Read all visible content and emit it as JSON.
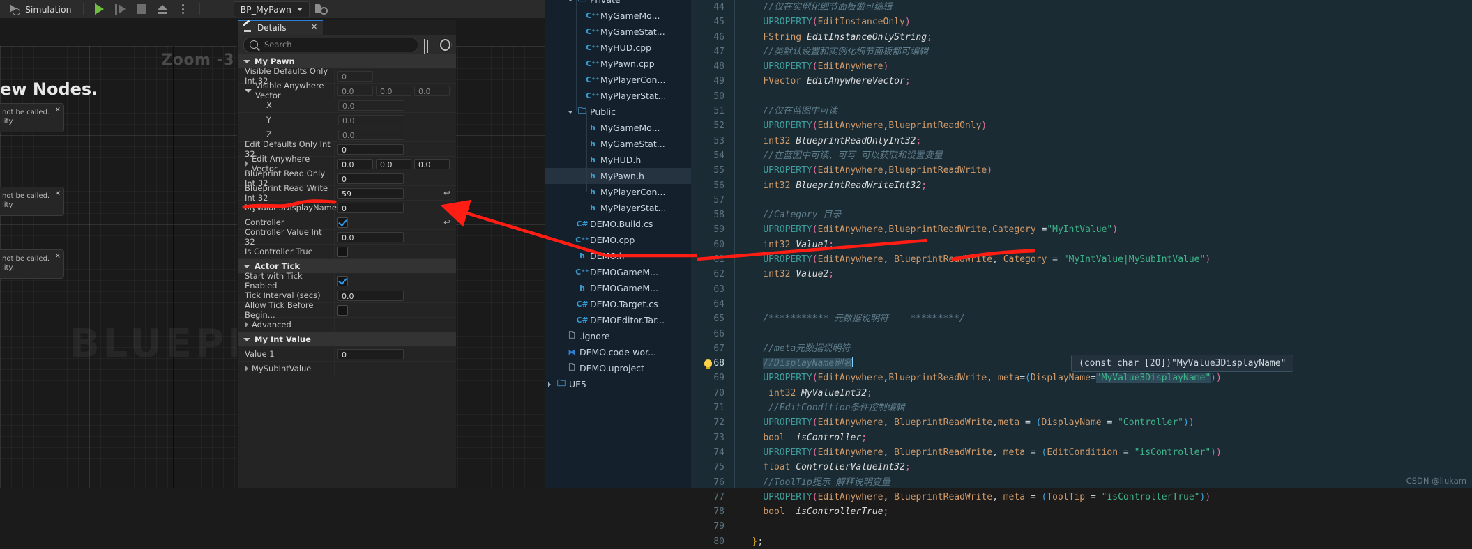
{
  "ue": {
    "toolbar": {
      "simulation_label": "Simulation",
      "play_icon": "play-icon",
      "skip_icon": "step-icon",
      "stop_icon": "stop-icon",
      "eject_icon": "eject-icon",
      "more_icon": "kebab-menu-icon",
      "blueprint_combo": "BP_MyPawn",
      "browse_icon": "browse-asset-icon"
    },
    "viewport": {
      "zoom_label": "Zoom -3",
      "watermark": "BLUEPRINT",
      "new_nodes_text": "New Nodes.",
      "comment_nodes": [
        {
          "text": "not be called.\nlity."
        },
        {
          "text": "not be called.\nlity."
        },
        {
          "text": "not be called.\nlity."
        }
      ]
    }
  },
  "details": {
    "tab_title": "Details",
    "tab_icon": "details-pen-icon",
    "close_icon": "close-icon",
    "search_placeholder": "Search",
    "search_value": "",
    "grid_icon": "column-layout-icon",
    "settings_icon": "gear-icon",
    "sections": [
      {
        "title": "My Pawn",
        "expanded": true,
        "rows": [
          {
            "label": "Visible Defaults Only Int 32",
            "type": "number",
            "value": "0",
            "dim": true,
            "indent": 1
          },
          {
            "label": "Visible Anywhere Vector",
            "type": "vector",
            "values": [
              "0.0",
              "0.0",
              "0.0"
            ],
            "dim": true,
            "indent": 1,
            "expanded": true
          },
          {
            "label": "X",
            "type": "number",
            "value": "0.0",
            "dim": true,
            "indent": 2,
            "wide": true
          },
          {
            "label": "Y",
            "type": "number",
            "value": "0.0",
            "dim": true,
            "indent": 2,
            "wide": true
          },
          {
            "label": "Z",
            "type": "number",
            "value": "0.0",
            "dim": true,
            "indent": 2,
            "wide": true
          },
          {
            "label": "Edit Defaults Only Int 32",
            "type": "number",
            "value": "0",
            "indent": 1,
            "wide": true
          },
          {
            "label": "Edit Anywhere Vector",
            "type": "vector",
            "values": [
              "0.0",
              "0.0",
              "0.0"
            ],
            "indent": 1,
            "collapsed": true
          },
          {
            "label": "Blueprint Read Only Int 32",
            "type": "number",
            "value": "0",
            "indent": 1,
            "wide": true
          },
          {
            "label": "Blueprint Read Write Int 32",
            "type": "number",
            "value": "59",
            "indent": 1,
            "wide": true,
            "revert": true
          },
          {
            "label": "MyValue3DisplayName",
            "type": "number",
            "value": "0",
            "indent": 1,
            "wide": true
          },
          {
            "label": "Controller",
            "type": "checkbox",
            "checked": true,
            "indent": 1,
            "revert": true
          },
          {
            "label": "Controller Value Int 32",
            "type": "number",
            "value": "0.0",
            "indent": 1,
            "wide": true
          },
          {
            "label": "Is Controller True",
            "type": "checkbox",
            "checked": false,
            "indent": 1
          }
        ]
      },
      {
        "title": "Actor Tick",
        "expanded": true,
        "rows": [
          {
            "label": "Start with Tick Enabled",
            "type": "checkbox",
            "checked": true,
            "indent": 1
          },
          {
            "label": "Tick Interval (secs)",
            "type": "number",
            "value": "0.0",
            "indent": 1,
            "wide": true
          },
          {
            "label": "Allow Tick Before Begin...",
            "type": "checkbox",
            "checked": false,
            "indent": 1
          },
          {
            "label": "Advanced",
            "type": "group",
            "collapsed": true,
            "indent": 0
          }
        ]
      },
      {
        "title": "My Int Value",
        "expanded": true,
        "rows": [
          {
            "label": "Value 1",
            "type": "number",
            "value": "0",
            "indent": 1,
            "wide": true
          },
          {
            "label": "MySubIntValue",
            "type": "group",
            "collapsed": true,
            "indent": 0
          }
        ]
      }
    ]
  },
  "explorer": {
    "items": [
      {
        "label": "Private",
        "icon": "folder-icon",
        "indent": 2,
        "chevron": "down",
        "partial": true
      },
      {
        "label": "MyGameMo...",
        "icon": "cpp-icon",
        "indent": 3
      },
      {
        "label": "MyGameStat...",
        "icon": "cpp-icon",
        "indent": 3
      },
      {
        "label": "MyHUD.cpp",
        "icon": "cpp-icon",
        "indent": 3
      },
      {
        "label": "MyPawn.cpp",
        "icon": "cpp-icon",
        "indent": 3
      },
      {
        "label": "MyPlayerCon...",
        "icon": "cpp-icon",
        "indent": 3
      },
      {
        "label": "MyPlayerStat...",
        "icon": "cpp-icon",
        "indent": 3
      },
      {
        "label": "Public",
        "icon": "folder-icon",
        "indent": 2,
        "chevron": "down"
      },
      {
        "label": "MyGameMo...",
        "icon": "h-icon",
        "indent": 3
      },
      {
        "label": "MyGameStat...",
        "icon": "h-icon",
        "indent": 3
      },
      {
        "label": "MyHUD.h",
        "icon": "h-icon",
        "indent": 3
      },
      {
        "label": "MyPawn.h",
        "icon": "h-icon",
        "indent": 3,
        "selected": true
      },
      {
        "label": "MyPlayerCon...",
        "icon": "h-icon",
        "indent": 3
      },
      {
        "label": "MyPlayerStat...",
        "icon": "h-icon",
        "indent": 3
      },
      {
        "label": "DEMO.Build.cs",
        "icon": "csharp-icon",
        "indent": 2
      },
      {
        "label": "DEMO.cpp",
        "icon": "cpp-icon",
        "indent": 2
      },
      {
        "label": "DEMO.h",
        "icon": "h-icon",
        "indent": 2
      },
      {
        "label": "DEMOGameM...",
        "icon": "cpp-icon",
        "indent": 2
      },
      {
        "label": "DEMOGameM...",
        "icon": "h-icon",
        "indent": 2
      },
      {
        "label": "DEMO.Target.cs",
        "icon": "csharp-icon",
        "indent": 2
      },
      {
        "label": "DEMOEditor.Tar...",
        "icon": "csharp-icon",
        "indent": 2
      },
      {
        "label": ".ignore",
        "icon": "file-icon",
        "indent": 1
      },
      {
        "label": "DEMO.code-wor...",
        "icon": "vscode-icon",
        "indent": 1
      },
      {
        "label": "DEMO.uproject",
        "icon": "file-icon",
        "indent": 1
      },
      {
        "label": "UE5",
        "icon": "folder-plain-icon",
        "indent": 0,
        "chevron": "right"
      }
    ]
  },
  "editor": {
    "first_line": 44,
    "cursor_line": 68,
    "bulb_icon": "lightbulb-icon",
    "lines": [
      {
        "n": 44,
        "html": "    <span class=\"cmt\">//仅在实例化细节面板做可编辑</span>"
      },
      {
        "n": 45,
        "html": "    <span class=\"kw\">UPROPERTY</span><span class=\"pn\">(</span><span class=\"ty\">EditInstanceOnly</span><span class=\"pn\">)</span>"
      },
      {
        "n": 46,
        "html": "    <span class=\"ty\">FString</span> <span class=\"id\">EditInstanceOnlyString</span><span class=\"pn\">;</span>"
      },
      {
        "n": 47,
        "html": "    <span class=\"cmt\">//类默认设置和实例化细节面板都可编辑</span>"
      },
      {
        "n": 48,
        "html": "    <span class=\"kw\">UPROPERTY</span><span class=\"pn\">(</span><span class=\"ty\">EditAnywhere</span><span class=\"pn\">)</span>"
      },
      {
        "n": 49,
        "html": "    <span class=\"ty\">FVector</span> <span class=\"id\">EditAnywhereVector</span><span class=\"pn\">;</span>"
      },
      {
        "n": 50,
        "html": ""
      },
      {
        "n": 51,
        "html": "    <span class=\"cmt\">//仅在蓝图中可读</span>"
      },
      {
        "n": 52,
        "html": "    <span class=\"kw\">UPROPERTY</span><span class=\"pn\">(</span><span class=\"ty\">EditAnywhere</span><span class=\"punct\">,</span><span class=\"ty\">BlueprintReadOnly</span><span class=\"pn\">)</span>"
      },
      {
        "n": 53,
        "html": "    <span class=\"ty\">int32</span> <span class=\"id\">BlueprintReadOnlyInt32</span><span class=\"pn\">;</span>"
      },
      {
        "n": 54,
        "html": "    <span class=\"cmt\">//在蓝图中可读、可写 可以获取和设置变量</span>"
      },
      {
        "n": 55,
        "html": "    <span class=\"kw\">UPROPERTY</span><span class=\"pn\">(</span><span class=\"ty\">EditAnywhere</span><span class=\"punct\">,</span><span class=\"ty\">BlueprintReadWrite</span><span class=\"pn\">)</span>"
      },
      {
        "n": 56,
        "html": "    <span class=\"ty\">int32</span> <span class=\"id\">BlueprintReadWriteInt32</span><span class=\"pn\">;</span>"
      },
      {
        "n": 57,
        "html": ""
      },
      {
        "n": 58,
        "html": "    <span class=\"cmt\">//Category 目录</span>"
      },
      {
        "n": 59,
        "html": "    <span class=\"kw\">UPROPERTY</span><span class=\"pn\">(</span><span class=\"ty\">EditAnywhere</span><span class=\"punct\">,</span><span class=\"ty\">BlueprintReadWrite</span><span class=\"punct\">,</span><span class=\"ty\">Category </span><span class=\"punct\">=</span><span class=\"str\">\"MyIntValue\"</span><span class=\"pn\">)</span>"
      },
      {
        "n": 60,
        "html": "    <span class=\"ty\">int32</span> <span class=\"id\">Value1</span><span class=\"pn\">;</span>"
      },
      {
        "n": 61,
        "html": "    <span class=\"kw\">UPROPERTY</span><span class=\"pn\">(</span><span class=\"ty\">EditAnywhere</span><span class=\"punct\">, </span><span class=\"ty\">BlueprintReadWrite</span><span class=\"punct\">, </span><span class=\"ty\">Category </span><span class=\"punct\">= </span><span class=\"str\">\"MyIntValue|MySubIntValue\"</span><span class=\"pn\">)</span>"
      },
      {
        "n": 62,
        "html": "    <span class=\"ty\">int32</span> <span class=\"id\">Value2</span><span class=\"pn\">;</span>"
      },
      {
        "n": 63,
        "html": ""
      },
      {
        "n": 64,
        "html": ""
      },
      {
        "n": 65,
        "html": "    <span class=\"cmt\">/*********** 元数据说明符    *********/</span>"
      },
      {
        "n": 66,
        "html": ""
      },
      {
        "n": 67,
        "html": "    <span class=\"cmt\">//meta元数据说明符</span>"
      },
      {
        "n": 68,
        "html": "    <span class=\"cmt sel-txt\">//DisplayName别名</span><span class=\"caret\"></span>"
      },
      {
        "n": 69,
        "html": "    <span class=\"kw\">UPROPERTY</span><span class=\"pn\">(</span><span class=\"ty\">EditAnywhere</span><span class=\"punct\">,</span><span class=\"ty\">BlueprintReadWrite</span><span class=\"punct\">, </span><span class=\"ty\">meta</span><span class=\"punct\">=</span><span class=\"pn2\">(</span><span class=\"ty\">DisplayName</span><span class=\"punct\">=</span><span class=\"str sel-txt\">\"MyValue3DisplayName\"</span><span class=\"pn2\">)</span><span class=\"pn\">)</span>"
      },
      {
        "n": 70,
        "html": "     <span class=\"ty\">int32</span> <span class=\"id\">MyValueInt32</span><span class=\"pn\">;</span>"
      },
      {
        "n": 71,
        "html": "     <span class=\"cmt\">//EditCondition条件控制编辑</span>"
      },
      {
        "n": 72,
        "html": "    <span class=\"kw\">UPROPERTY</span><span class=\"pn\">(</span><span class=\"ty\">EditAnywhere</span><span class=\"punct\">, </span><span class=\"ty\">BlueprintReadWrite</span><span class=\"punct\">,</span><span class=\"ty\">meta </span><span class=\"punct\">= </span><span class=\"pn2\">(</span><span class=\"ty\">DisplayName </span><span class=\"punct\">= </span><span class=\"str\">\"Controller\"</span><span class=\"pn2\">)</span><span class=\"pn\">)</span>"
      },
      {
        "n": 73,
        "html": "    <span class=\"ty\">bool</span>  <span class=\"id\">isController</span><span class=\"pn\">;</span>"
      },
      {
        "n": 74,
        "html": "    <span class=\"kw\">UPROPERTY</span><span class=\"pn\">(</span><span class=\"ty\">EditAnywhere</span><span class=\"punct\">, </span><span class=\"ty\">BlueprintReadWrite</span><span class=\"punct\">, </span><span class=\"ty\">meta </span><span class=\"punct\">= </span><span class=\"pn2\">(</span><span class=\"ty\">EditCondition </span><span class=\"punct\">= </span><span class=\"str\">\"isController\"</span><span class=\"pn2\">)</span><span class=\"pn\">)</span>"
      },
      {
        "n": 75,
        "html": "    <span class=\"ty\">float</span> <span class=\"id\">ControllerValueInt32</span><span class=\"pn\">;</span>"
      },
      {
        "n": 76,
        "html": "    <span class=\"cmt\">//ToolTip提示 解释说明变量</span>"
      },
      {
        "n": 77,
        "html": "    <span class=\"kw\">UPROPERTY</span><span class=\"pn\">(</span><span class=\"ty\">EditAnywhere</span><span class=\"punct\">, </span><span class=\"ty\">BlueprintReadWrite</span><span class=\"punct\">, </span><span class=\"ty\">meta </span><span class=\"punct\">= </span><span class=\"pn2\">(</span><span class=\"ty\">ToolTip </span><span class=\"punct\">= </span><span class=\"str\">\"isControllerTrue\"</span><span class=\"pn2\">)</span><span class=\"pn\">)</span>"
      },
      {
        "n": 78,
        "html": "    <span class=\"ty\">bool</span>  <span class=\"id\">isControllerTrue</span><span class=\"pn\">;</span>"
      },
      {
        "n": 79,
        "html": ""
      },
      {
        "n": 80,
        "html": "  <span class=\"pn3\">}</span><span class=\"punct\">;</span>"
      }
    ],
    "tooltip": "(const char [20])\"MyValue3DisplayName\"",
    "watermark": "CSDN @liukam"
  }
}
